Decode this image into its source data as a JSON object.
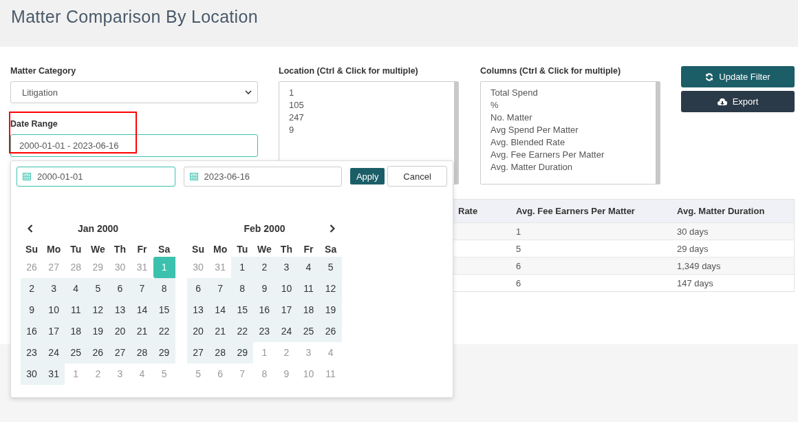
{
  "page": {
    "title": "Matter Comparison By Location"
  },
  "filters": {
    "matter_category": {
      "label": "Matter Category",
      "value": "Litigation"
    },
    "date_range": {
      "label": "Date Range",
      "value": "2000-01-01 - 2023-06-16",
      "highlighted": true
    },
    "location": {
      "label": "Location (Ctrl & Click for multiple)",
      "options": [
        "1",
        "105",
        "247",
        "9"
      ]
    },
    "columns": {
      "label": "Columns (Ctrl & Click for multiple)",
      "options": [
        "Total Spend",
        "%",
        "No. Matter",
        "Avg Spend Per Matter",
        "Avg. Blended Rate",
        "Avg. Fee Earners Per Matter",
        "Avg. Matter Duration"
      ]
    }
  },
  "buttons": [
    {
      "label": "Update Filter",
      "kind": "refresh"
    },
    {
      "label": "Export",
      "kind": "download"
    }
  ],
  "table": {
    "columns": [
      "Rate",
      "Avg. Fee Earners Per Matter",
      "Avg. Matter Duration"
    ],
    "rows": [
      [
        "",
        "1",
        "30 days"
      ],
      [
        "",
        "5",
        "29 days"
      ],
      [
        "",
        "6",
        "1,349 days"
      ],
      [
        "",
        "6",
        "147 days"
      ]
    ]
  },
  "datepicker": {
    "start": "2000-01-01",
    "end": "2023-06-16",
    "apply": "Apply",
    "cancel": "Cancel",
    "months": [
      {
        "title": "Jan 2000",
        "weekdays": [
          "Su",
          "Mo",
          "Tu",
          "We",
          "Th",
          "Fr",
          "Sa"
        ],
        "weeks": [
          [
            {
              "t": "26",
              "kind": "other"
            },
            {
              "t": "27",
              "kind": "other"
            },
            {
              "t": "28",
              "kind": "other"
            },
            {
              "t": "29",
              "kind": "other"
            },
            {
              "t": "30",
              "kind": "other"
            },
            {
              "t": "31",
              "kind": "other"
            },
            {
              "t": "1",
              "kind": "start"
            }
          ],
          [
            {
              "t": "2",
              "kind": "range"
            },
            {
              "t": "3",
              "kind": "range"
            },
            {
              "t": "4",
              "kind": "range"
            },
            {
              "t": "5",
              "kind": "range"
            },
            {
              "t": "6",
              "kind": "range"
            },
            {
              "t": "7",
              "kind": "range"
            },
            {
              "t": "8",
              "kind": "range"
            }
          ],
          [
            {
              "t": "9",
              "kind": "range"
            },
            {
              "t": "10",
              "kind": "range"
            },
            {
              "t": "11",
              "kind": "range"
            },
            {
              "t": "12",
              "kind": "range"
            },
            {
              "t": "13",
              "kind": "range"
            },
            {
              "t": "14",
              "kind": "range"
            },
            {
              "t": "15",
              "kind": "range"
            }
          ],
          [
            {
              "t": "16",
              "kind": "range"
            },
            {
              "t": "17",
              "kind": "range"
            },
            {
              "t": "18",
              "kind": "range"
            },
            {
              "t": "19",
              "kind": "range"
            },
            {
              "t": "20",
              "kind": "range"
            },
            {
              "t": "21",
              "kind": "range"
            },
            {
              "t": "22",
              "kind": "range"
            }
          ],
          [
            {
              "t": "23",
              "kind": "range"
            },
            {
              "t": "24",
              "kind": "range"
            },
            {
              "t": "25",
              "kind": "range"
            },
            {
              "t": "26",
              "kind": "range"
            },
            {
              "t": "27",
              "kind": "range"
            },
            {
              "t": "28",
              "kind": "range"
            },
            {
              "t": "29",
              "kind": "range"
            }
          ],
          [
            {
              "t": "30",
              "kind": "range"
            },
            {
              "t": "31",
              "kind": "range"
            },
            {
              "t": "1",
              "kind": "other"
            },
            {
              "t": "2",
              "kind": "other"
            },
            {
              "t": "3",
              "kind": "other"
            },
            {
              "t": "4",
              "kind": "other"
            },
            {
              "t": "5",
              "kind": "other"
            }
          ]
        ]
      },
      {
        "title": "Feb 2000",
        "weekdays": [
          "Su",
          "Mo",
          "Tu",
          "We",
          "Th",
          "Fr",
          "Sa"
        ],
        "weeks": [
          [
            {
              "t": "30",
              "kind": "other"
            },
            {
              "t": "31",
              "kind": "other"
            },
            {
              "t": "1",
              "kind": "range"
            },
            {
              "t": "2",
              "kind": "range"
            },
            {
              "t": "3",
              "kind": "range"
            },
            {
              "t": "4",
              "kind": "range"
            },
            {
              "t": "5",
              "kind": "range"
            }
          ],
          [
            {
              "t": "6",
              "kind": "range"
            },
            {
              "t": "7",
              "kind": "range"
            },
            {
              "t": "8",
              "kind": "range"
            },
            {
              "t": "9",
              "kind": "range"
            },
            {
              "t": "10",
              "kind": "range"
            },
            {
              "t": "11",
              "kind": "range"
            },
            {
              "t": "12",
              "kind": "range"
            }
          ],
          [
            {
              "t": "13",
              "kind": "range"
            },
            {
              "t": "14",
              "kind": "range"
            },
            {
              "t": "15",
              "kind": "range"
            },
            {
              "t": "16",
              "kind": "range"
            },
            {
              "t": "17",
              "kind": "range"
            },
            {
              "t": "18",
              "kind": "range"
            },
            {
              "t": "19",
              "kind": "range"
            }
          ],
          [
            {
              "t": "20",
              "kind": "range"
            },
            {
              "t": "21",
              "kind": "range"
            },
            {
              "t": "22",
              "kind": "range"
            },
            {
              "t": "23",
              "kind": "range"
            },
            {
              "t": "24",
              "kind": "range"
            },
            {
              "t": "25",
              "kind": "range"
            },
            {
              "t": "26",
              "kind": "range"
            }
          ],
          [
            {
              "t": "27",
              "kind": "range"
            },
            {
              "t": "28",
              "kind": "range"
            },
            {
              "t": "29",
              "kind": "range"
            },
            {
              "t": "1",
              "kind": "other"
            },
            {
              "t": "2",
              "kind": "other"
            },
            {
              "t": "3",
              "kind": "other"
            },
            {
              "t": "4",
              "kind": "other"
            }
          ],
          [
            {
              "t": "5",
              "kind": "other"
            },
            {
              "t": "6",
              "kind": "other"
            },
            {
              "t": "7",
              "kind": "other"
            },
            {
              "t": "8",
              "kind": "other"
            },
            {
              "t": "9",
              "kind": "other"
            },
            {
              "t": "10",
              "kind": "other"
            },
            {
              "t": "11",
              "kind": "other"
            }
          ]
        ]
      }
    ]
  }
}
